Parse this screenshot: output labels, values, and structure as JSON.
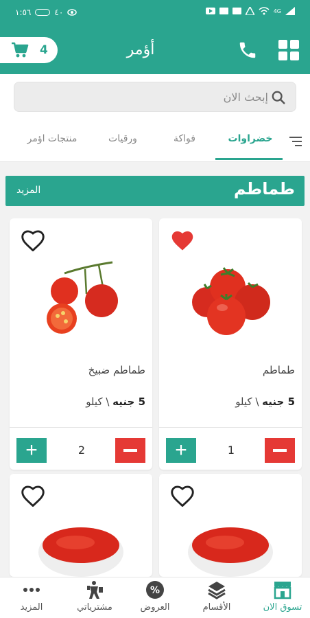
{
  "status_bar": {
    "time": "١:٥٦",
    "left_icons": [
      "battery-icon",
      "eye-icon"
    ],
    "battery_text": "٤٠",
    "right_icons": [
      "youtube-icon",
      "mail-icon",
      "mail-icon",
      "warning-icon",
      "wifi-icon",
      "signal-icon"
    ],
    "network": "4G"
  },
  "header": {
    "title": "أؤمر",
    "cart_count": "4",
    "accent": "#2aa58f"
  },
  "search": {
    "placeholder": "إبحث الان"
  },
  "tabs": [
    {
      "label": "خضراوات",
      "active": true
    },
    {
      "label": "فواكة",
      "active": false
    },
    {
      "label": "ورقيات",
      "active": false
    },
    {
      "label": "منتجات اؤمر",
      "active": false
    }
  ],
  "section": {
    "title": "طماطم",
    "more_label": "المزيد"
  },
  "products": [
    {
      "name": "طماطم",
      "price": "5 جنيه",
      "unit": " \\ كيلو",
      "quantity": "1",
      "favorite": true
    },
    {
      "name": "طماطم ضبيخ",
      "price": "5 جنيه",
      "unit": " \\ كيلو",
      "quantity": "2",
      "favorite": false
    },
    {
      "favorite": false
    },
    {
      "favorite": false
    }
  ],
  "bottom_nav": [
    {
      "label": "تسوق الان",
      "icon": "store-icon",
      "active": true
    },
    {
      "label": "الأقسام",
      "icon": "layers-icon",
      "active": false
    },
    {
      "label": "العروض",
      "icon": "percent-icon",
      "active": false
    },
    {
      "label": "مشترياتي",
      "icon": "shopping-person-icon",
      "active": false
    },
    {
      "label": "المزيد",
      "icon": "more-dots-icon",
      "active": false
    }
  ]
}
